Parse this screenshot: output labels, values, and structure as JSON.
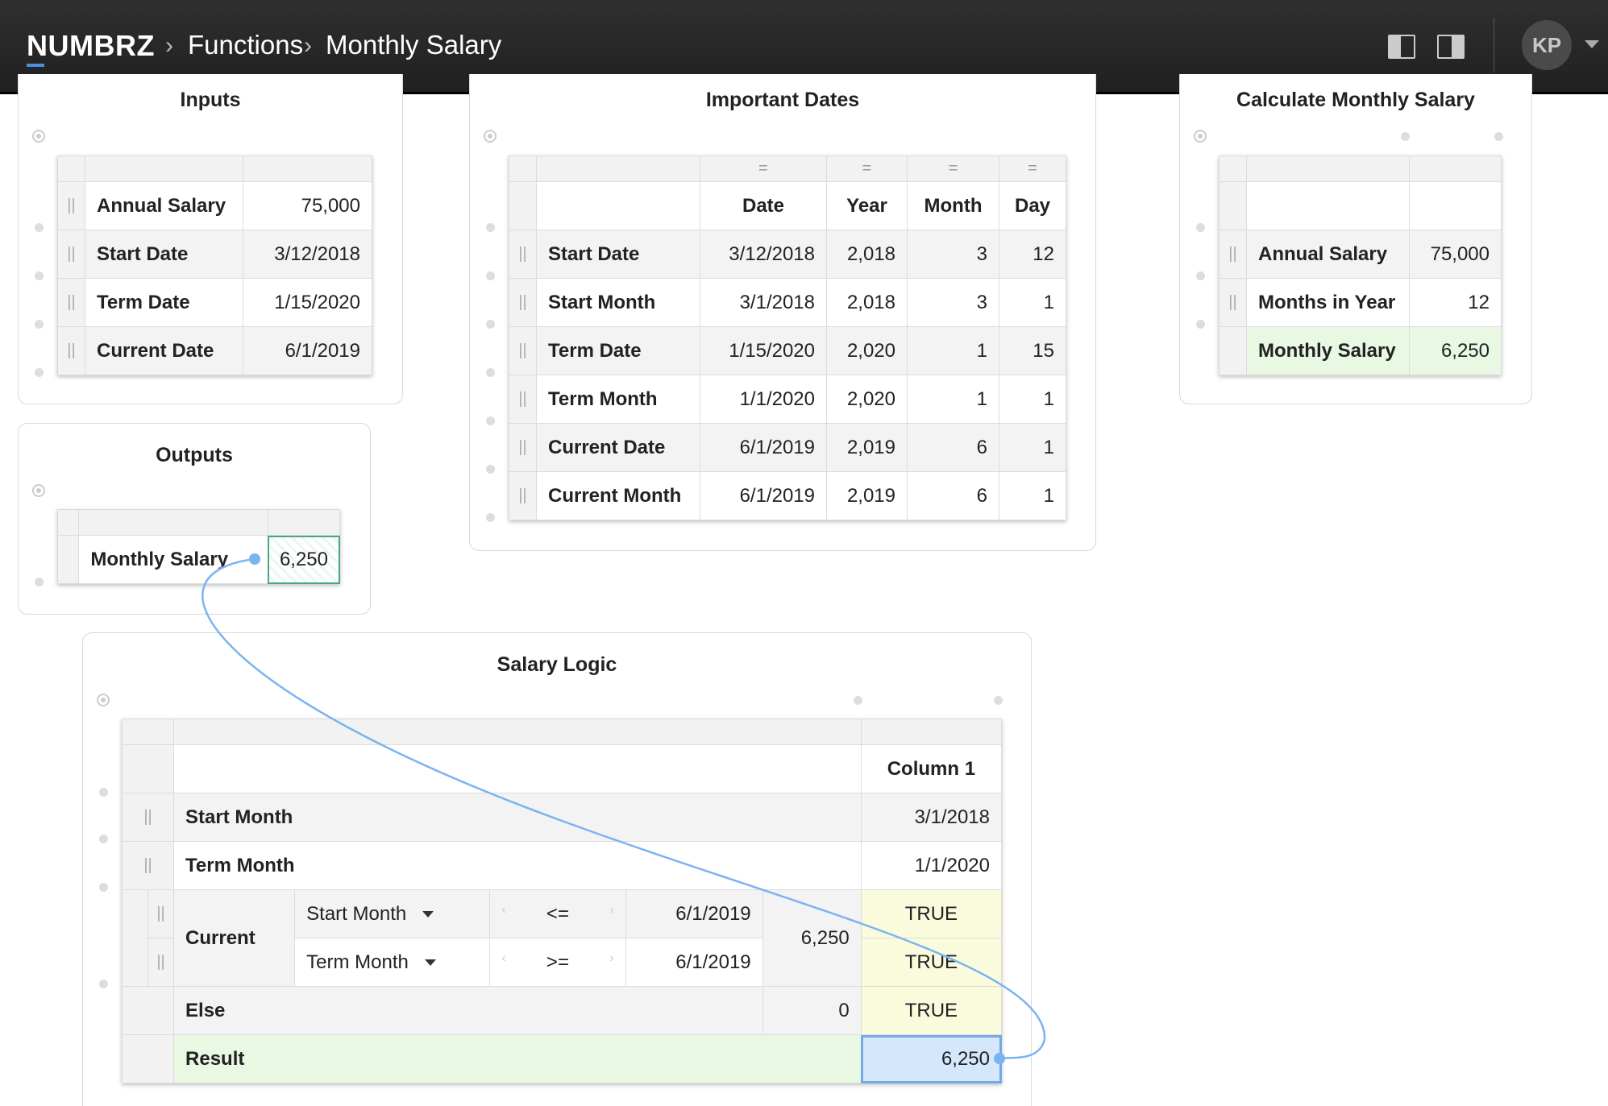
{
  "header": {
    "brand": "NUMBRZ",
    "breadcrumb": [
      "Functions",
      "Monthly Salary"
    ],
    "avatar_initials": "KP"
  },
  "inputs": {
    "title": "Inputs",
    "rows": [
      {
        "label": "Annual Salary",
        "value": "75,000"
      },
      {
        "label": "Start Date",
        "value": "3/12/2018"
      },
      {
        "label": "Term Date",
        "value": "1/15/2020"
      },
      {
        "label": "Current Date",
        "value": "6/1/2019"
      }
    ]
  },
  "outputs": {
    "title": "Outputs",
    "rows": [
      {
        "label": "Monthly Salary",
        "value": "6,250"
      }
    ]
  },
  "dates": {
    "title": "Important Dates",
    "header_mark": "=",
    "columns": [
      "Date",
      "Year",
      "Month",
      "Day"
    ],
    "rows": [
      {
        "label": "Start Date",
        "date": "3/12/2018",
        "year": "2,018",
        "month": "3",
        "day": "12"
      },
      {
        "label": "Start Month",
        "date": "3/1/2018",
        "year": "2,018",
        "month": "3",
        "day": "1"
      },
      {
        "label": "Term Date",
        "date": "1/15/2020",
        "year": "2,020",
        "month": "1",
        "day": "15"
      },
      {
        "label": "Term Month",
        "date": "1/1/2020",
        "year": "2,020",
        "month": "1",
        "day": "1"
      },
      {
        "label": "Current Date",
        "date": "6/1/2019",
        "year": "2,019",
        "month": "6",
        "day": "1"
      },
      {
        "label": "Current Month",
        "date": "6/1/2019",
        "year": "2,019",
        "month": "6",
        "day": "1"
      }
    ]
  },
  "calc": {
    "title": "Calculate Monthly Salary",
    "rows": [
      {
        "label": "Annual Salary",
        "value": "75,000"
      },
      {
        "label": "Months in Year",
        "value": "12"
      },
      {
        "label": "Monthly Salary",
        "value": "6,250"
      }
    ]
  },
  "logic": {
    "title": "Salary Logic",
    "column_header": "Column 1",
    "start_month": {
      "label": "Start Month",
      "value": "3/1/2018"
    },
    "term_month": {
      "label": "Term Month",
      "value": "1/1/2020"
    },
    "current": {
      "label": "Current",
      "result": "6,250",
      "conditions": [
        {
          "field": "Start Month",
          "op": "<=",
          "value": "6/1/2019",
          "result": "TRUE"
        },
        {
          "field": "Term Month",
          "op": ">=",
          "value": "6/1/2019",
          "result": "TRUE"
        }
      ]
    },
    "else": {
      "label": "Else",
      "value": "0",
      "result": "TRUE"
    },
    "result": {
      "label": "Result",
      "value": "6,250"
    }
  },
  "colors": {
    "accent": "#4a90e2",
    "connector": "#7ab4f0",
    "green_fill": "#e8f8e2",
    "yellow_fill": "#fafbdc",
    "selected_blue": "#d5e8fb"
  }
}
